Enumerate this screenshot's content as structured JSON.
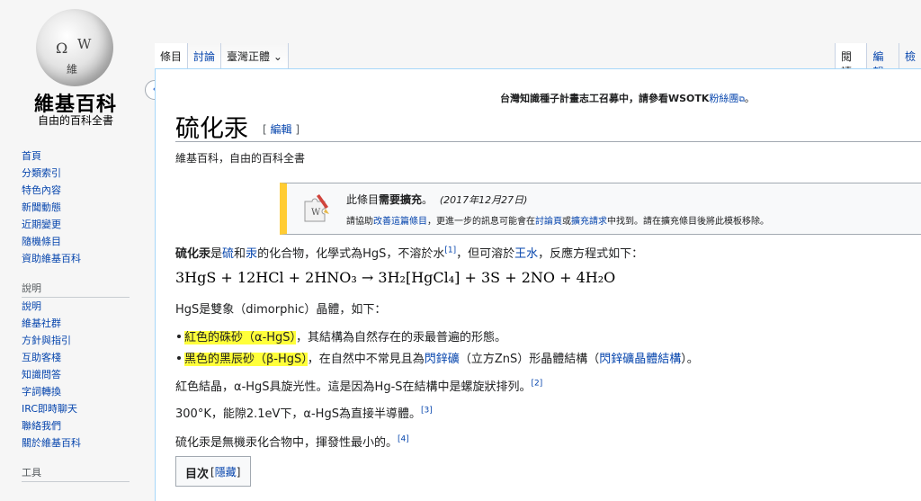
{
  "logo": {
    "title": "維基百科",
    "subtitle": "自由的百科全書",
    "glyphs": [
      "Ω",
      "W",
      "維"
    ]
  },
  "sidebar": {
    "nav": [
      "首頁",
      "分類索引",
      "特色內容",
      "新聞動態",
      "近期變更",
      "隨機條目",
      "資助維基百科"
    ],
    "help_heading": "說明",
    "help": [
      "說明",
      "維基社群",
      "方針與指引",
      "互助客棧",
      "知識問答",
      "字詞轉換",
      "IRC即時聊天",
      "聯絡我們",
      "關於維基百科"
    ],
    "tools_heading": "工具",
    "collapse_icon": "‹"
  },
  "tabs": {
    "left": [
      "條目",
      "討論"
    ],
    "variant": "臺灣正體",
    "variant_icon": "⌄",
    "right": [
      "閱讀",
      "編輯",
      "檢"
    ]
  },
  "sitenotice": {
    "prefix": "台灣知識種子計畫志工召募中，請參看WSOTK",
    "link": "粉絲團",
    "suffix": "。"
  },
  "article": {
    "title": "硫化汞",
    "edit_open": "[ ",
    "edit_link": "編輯",
    "edit_close": " ]",
    "tagline": "維基百科，自由的百科全書"
  },
  "notice": {
    "icon": "puzzle-brush-icon",
    "text_a": "此條目",
    "text_bold": "需要擴充",
    "text_b": "。",
    "date": "(2017年12月27日)",
    "l2_a": "請協助",
    "l2_link1": "改善這篇條目",
    "l2_b": "，更進一步的訊息可能會在",
    "l2_link2": "討論頁",
    "l2_c": "或",
    "l2_link3": "擴充請求",
    "l2_d": "中找到。請在擴充條目後將此模板移除。"
  },
  "intro": {
    "bold": "硫化汞",
    "t1": "是",
    "link1": "硫",
    "t2": "和",
    "link2": "汞",
    "t3": "的化合物，化學式為HgS，不溶於水",
    "ref1": "[1]",
    "t4": "，但可溶於",
    "link3": "王水",
    "t5": "，反應方程式如下："
  },
  "formula": {
    "text": "3HgS + 12HCl + 2HNO₃ → 3H₂[HgCl₄] + 3S + 2NO + 4H₂O"
  },
  "dimorphic": "HgS是雙象（dimorphic）晶體，如下：",
  "bullet1": {
    "highlight": "紅色的硃砂（α-HgS）",
    "rest": "，其結構為自然存在的汞最普遍的形態。"
  },
  "bullet2": {
    "highlight": "黑色的黑辰砂（β-HgS）",
    "t1": "，在自然中不常見且為",
    "link1": "閃鋅礦",
    "t2": "（立方ZnS）形晶體結構（",
    "link2": "閃鋅礦晶體結構",
    "t3": "）。"
  },
  "para_optical": {
    "text": "紅色結晶，α-HgS具旋光性。這是因為Hg-S在結構中是螺旋狀排列。",
    "ref": "[2]"
  },
  "para_band": {
    "text": "300°K，能隙2.1eV下，α-HgS為直接半導體。",
    "ref": "[3]"
  },
  "para_volatile": {
    "text": "硫化汞是無機汞化合物中，揮發性最小的。",
    "ref": "[4]"
  },
  "toc": {
    "title": "目次",
    "open": " [",
    "toggle": "隱藏",
    "close": "]"
  },
  "colors": {
    "link": "#0645ad",
    "highlight": "#ffff3a",
    "notice_bar": "#ffcc33"
  }
}
